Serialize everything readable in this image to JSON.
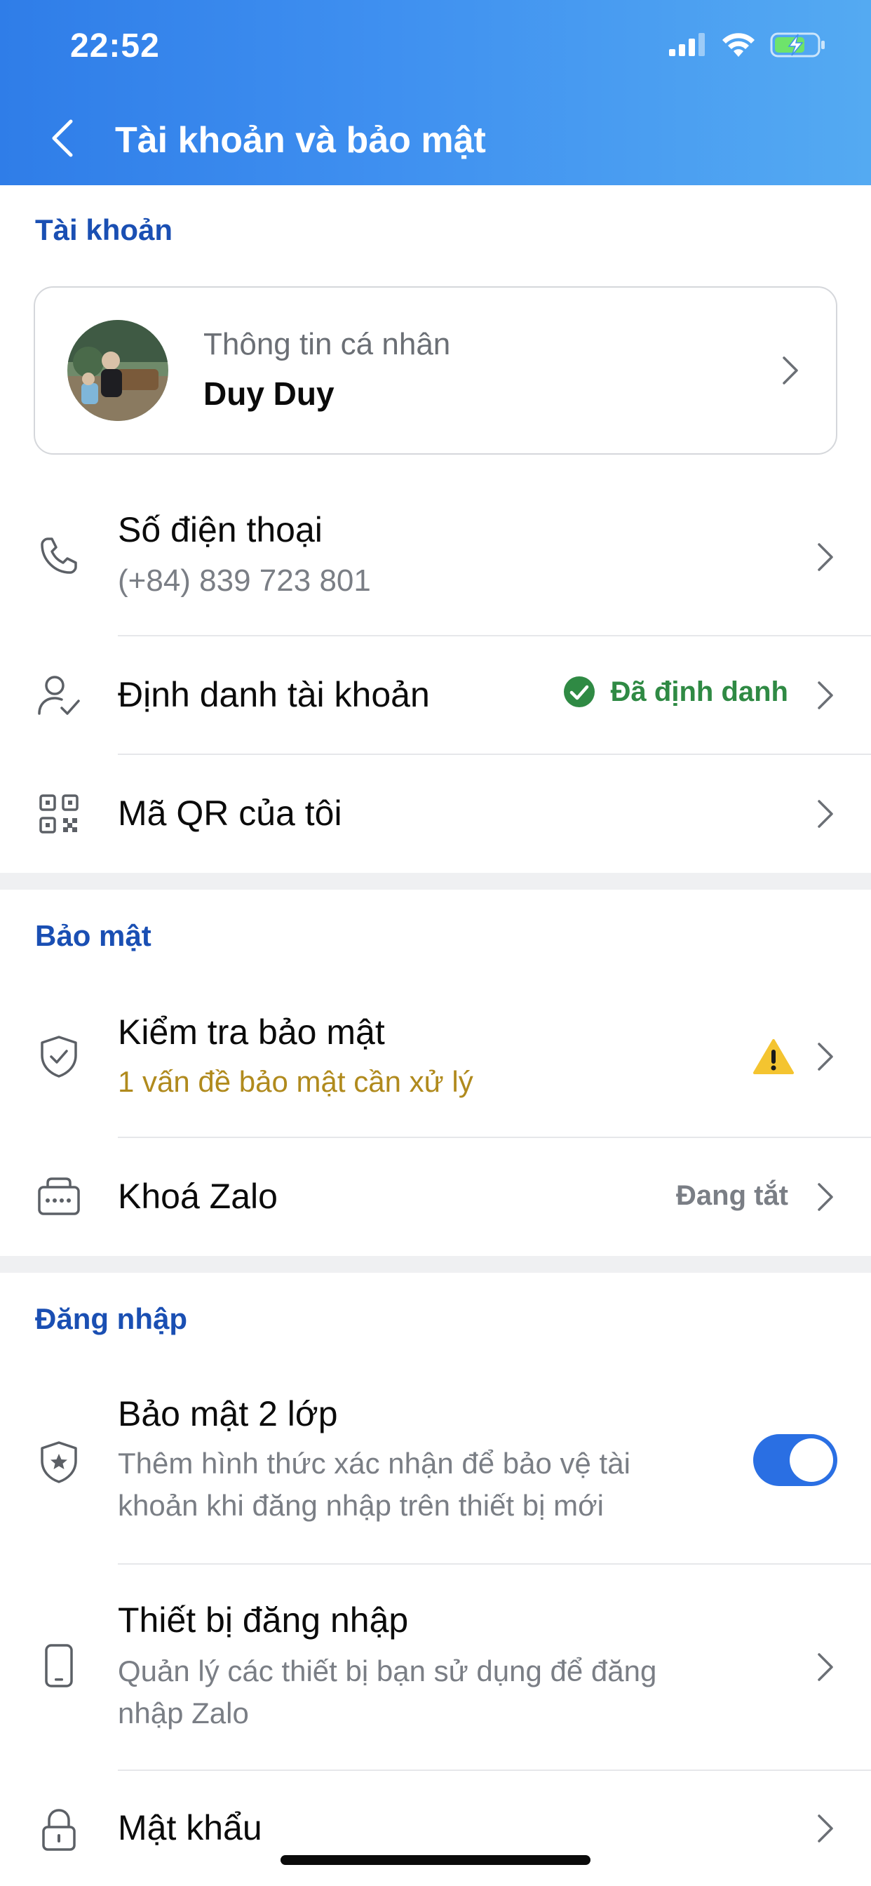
{
  "status_bar": {
    "time": "22:52"
  },
  "header": {
    "title": "Tài khoản và bảo mật"
  },
  "sections": {
    "account": "Tài khoản",
    "security": "Bảo mật",
    "login": "Đăng nhập"
  },
  "profile": {
    "label": "Thông tin cá nhân",
    "name": "Duy Duy"
  },
  "rows": {
    "phone": {
      "title": "Số điện thoại",
      "subtitle": "(+84) 839 723 801"
    },
    "identity": {
      "title": "Định danh tài khoản",
      "status": "Đã định danh"
    },
    "qr": {
      "title": "Mã QR của tôi"
    },
    "security_check": {
      "title": "Kiểm tra bảo mật",
      "subtitle": "1 vấn đề bảo mật cần xử lý"
    },
    "lock": {
      "title": "Khoá Zalo",
      "status": "Đang tắt"
    },
    "two_factor": {
      "title": "Bảo mật 2 lớp",
      "subtitle_line1": "Thêm hình thức xác nhận để bảo vệ tài",
      "subtitle_line2": "khoản khi đăng nhập trên thiết bị mới",
      "enabled": true
    },
    "devices": {
      "title": "Thiết bị đăng nhập",
      "subtitle_line1": "Quản lý các thiết bị bạn sử dụng để đăng",
      "subtitle_line2": "nhập Zalo"
    },
    "password": {
      "title": "Mật khẩu"
    }
  },
  "colors": {
    "header_gradient_start": "#2f7de8",
    "header_gradient_end": "#54aaf2",
    "section_title": "#1a4fb3",
    "verified_green": "#2f8a44",
    "warning_amber": "#b08a1d",
    "toggle_on": "#2a6fe3"
  },
  "icons": [
    "chevron-left-icon",
    "signal-icon",
    "wifi-icon",
    "battery-charging-icon",
    "phone-icon",
    "user-check-icon",
    "qr-code-icon",
    "shield-check-icon",
    "warning-icon",
    "keyboard-lock-icon",
    "shield-star-icon",
    "smartphone-icon",
    "lock-icon",
    "chevron-right-icon"
  ]
}
